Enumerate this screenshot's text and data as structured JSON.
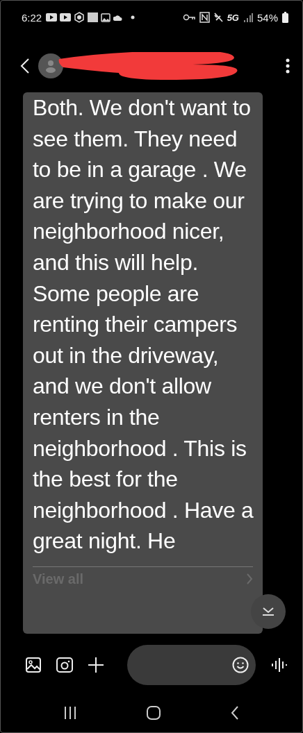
{
  "status_bar": {
    "time": "6:22",
    "network": "5G",
    "battery": "54%"
  },
  "message": {
    "text": "Both. We don't want to see them. They need to be in a garage . We are trying to make our neighborhood nicer, and this will help. Some people are renting their campers out in the driveway, and we don't allow renters in the neighborhood . This is the best for the neighborhood . Have a great night. He",
    "link": "View all"
  }
}
